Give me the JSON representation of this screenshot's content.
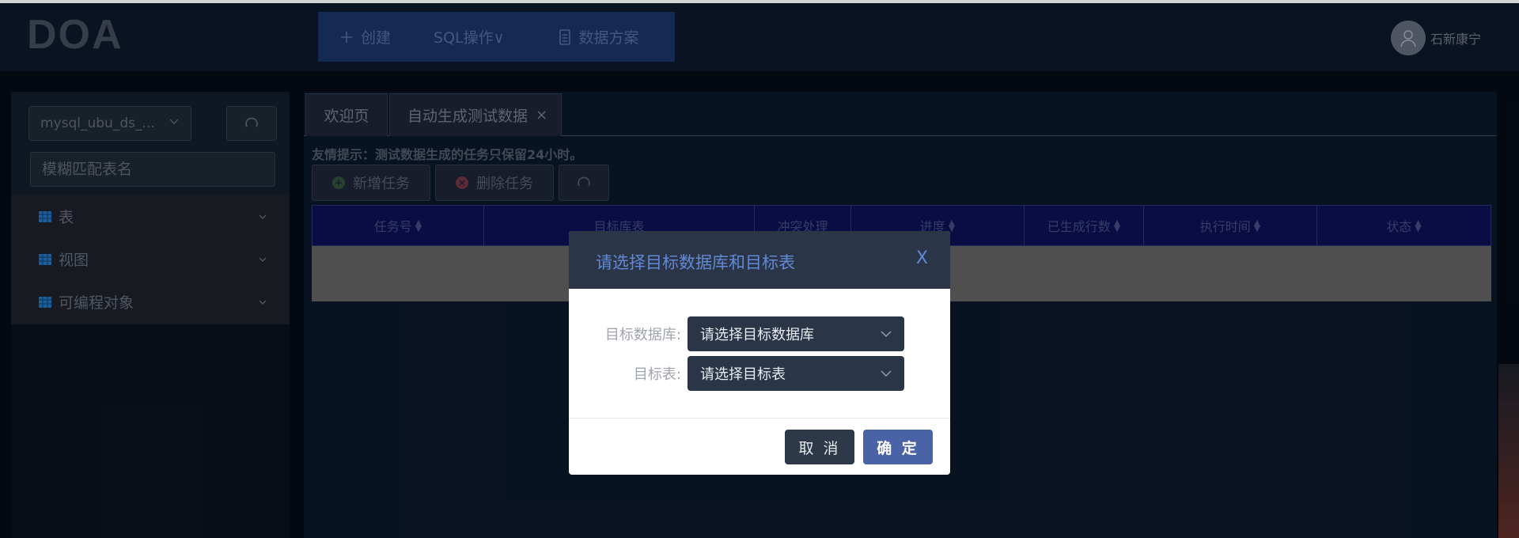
{
  "header": {
    "logo": "DOA",
    "menu": [
      {
        "label": "创建",
        "icon": "plus-icon"
      },
      {
        "label": "SQL操作∨",
        "icon": ""
      },
      {
        "label": "数据方案",
        "icon": "document-icon"
      }
    ],
    "user": {
      "name": "石新康宁",
      "icon": "user-avatar-icon"
    }
  },
  "sidebar": {
    "db_select": "mysql_ubu_ds_...",
    "search_placeholder": "模糊匹配表名",
    "tree": [
      {
        "label": "表",
        "icon": "calendar-icon"
      },
      {
        "label": "视图",
        "icon": "calendar-icon"
      },
      {
        "label": "可编程对象",
        "icon": "calendar-icon"
      }
    ]
  },
  "main": {
    "tabs": [
      {
        "label": "欢迎页"
      },
      {
        "label": "自动生成测试数据",
        "close": "×"
      }
    ],
    "notice": "友情提示：测试数据生成的任务只保留24小时。",
    "toolbar": {
      "add_label": "新增任务",
      "delete_label": "删除任务"
    },
    "table": {
      "columns": [
        "任务号",
        "目标库表",
        "冲突处理",
        "进度",
        "已生成行数",
        "执行时间",
        "状态"
      ]
    }
  },
  "modal": {
    "title": "请选择目标数据库和目标表",
    "close": "X",
    "db_label": "目标数据库:",
    "db_placeholder": "请选择目标数据库",
    "table_label": "目标表:",
    "table_placeholder": "请选择目标表",
    "cancel": "取 消",
    "ok": "确 定"
  },
  "colors": {
    "modal_header": "#2a3548",
    "accent": "#4a62a6",
    "table_header": "#0b0f4d"
  }
}
